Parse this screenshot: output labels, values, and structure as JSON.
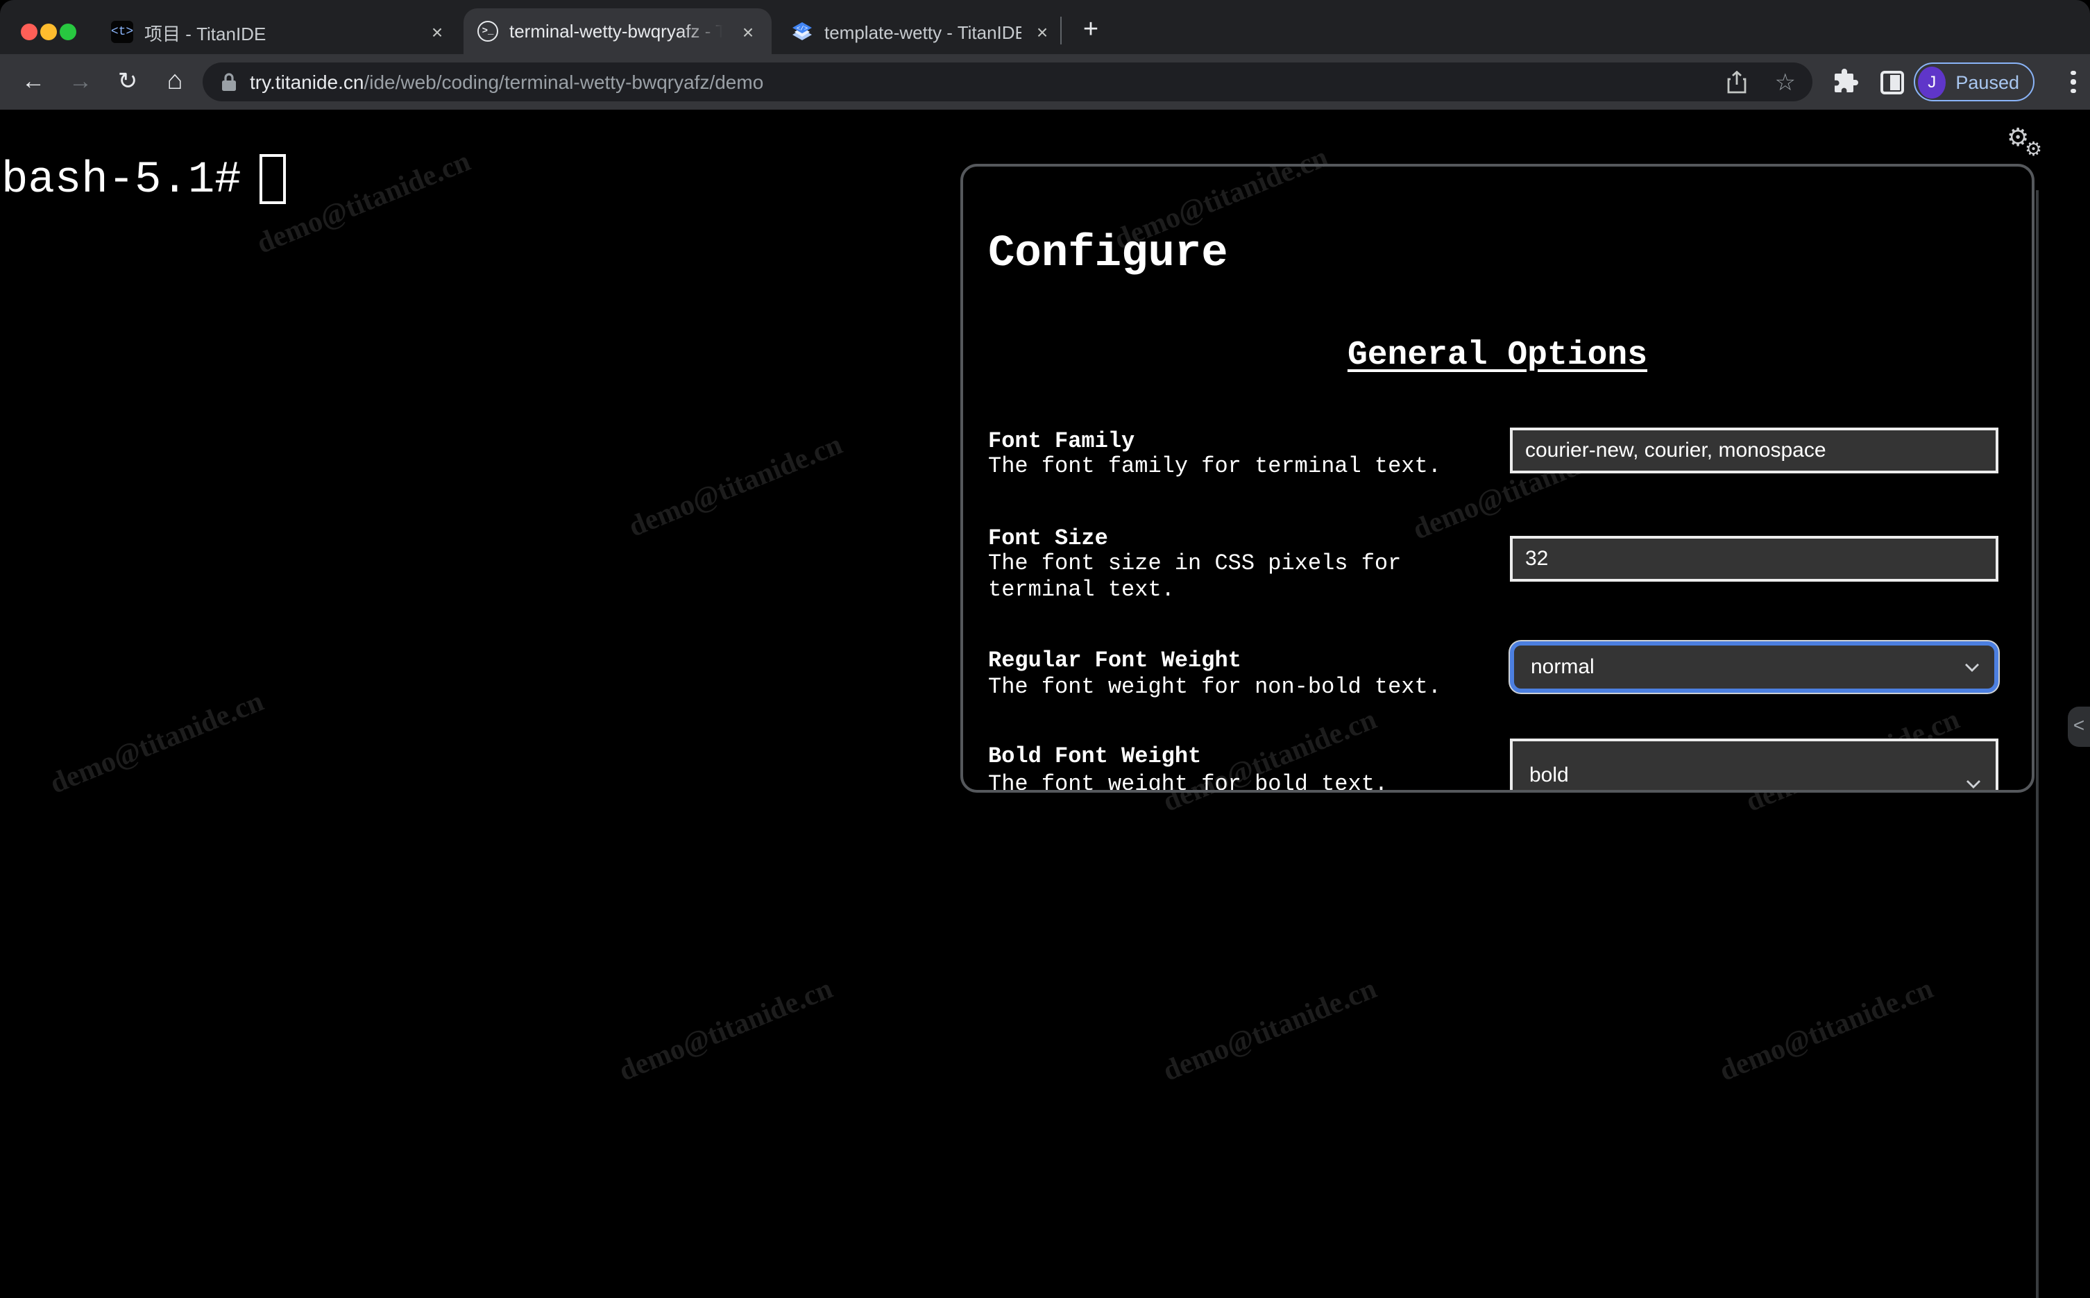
{
  "browser": {
    "tabs": [
      {
        "title": "项目 - TitanIDE",
        "favicon": "titanide-logo-icon",
        "favicon_glyph": "<t>",
        "active": false
      },
      {
        "title": "terminal-wetty-bwqryafz - Tita",
        "favicon": "terminal-circle-icon",
        "favicon_glyph": ">_",
        "active": true
      },
      {
        "title": "template-wetty - TitanIDE",
        "favicon": "blue-layers-icon",
        "active": false
      }
    ],
    "tab_close_glyph": "×",
    "new_tab_glyph": "+",
    "nav": {
      "back": "←",
      "forward": "→",
      "reload": "↻",
      "home": "⌂"
    },
    "omnibox": {
      "host": "try.titanide.cn",
      "path": "/ide/web/coding/terminal-wetty-bwqryafz/demo",
      "bookmark_glyph": "☆"
    },
    "profile": {
      "initial": "J",
      "status": "Paused"
    }
  },
  "page": {
    "terminal": {
      "prompt": "bash-5.1#"
    },
    "watermark": {
      "text": "demo@titanide.cn"
    },
    "settings_gear_glyph": "⚙",
    "drawer_toggle_glyph": "<",
    "configure": {
      "title": "Configure",
      "section_heading": "General Options",
      "fields": [
        {
          "label": "Font Family",
          "description": "The font family for terminal text.",
          "type": "input",
          "value": "courier-new, courier, monospace"
        },
        {
          "label": "Font Size",
          "description": "The font size in CSS pixels for terminal text.",
          "type": "input",
          "value": "32"
        },
        {
          "label": "Regular Font Weight",
          "description": "The font weight for non-bold text.",
          "type": "select",
          "value": "normal",
          "focused": true
        },
        {
          "label": "Bold Font Weight",
          "description": "The font weight for bold text.",
          "type": "select",
          "value": "bold",
          "focused": false
        }
      ]
    }
  },
  "colors": {
    "frame": "#202124",
    "toolbar": "#35363a",
    "page_background": "#000000",
    "paused_accent": "#8ab4f8",
    "avatar_purple": "#5f36c9",
    "select_focus_blue": "#4c7fe0",
    "panel_border": "#55585c"
  }
}
